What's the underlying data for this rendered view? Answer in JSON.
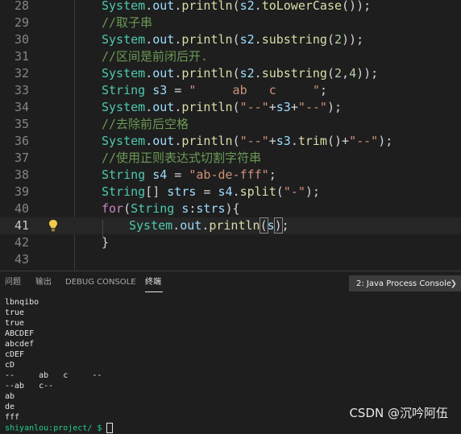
{
  "editor": {
    "lines": [
      {
        "num": "28",
        "tokens": [
          {
            "t": "System",
            "c": "cls"
          },
          {
            "t": ".",
            "c": "p"
          },
          {
            "t": "out",
            "c": "var"
          },
          {
            "t": ".",
            "c": "p"
          },
          {
            "t": "println",
            "c": "fn"
          },
          {
            "t": "(",
            "c": "p"
          },
          {
            "t": "s2",
            "c": "var"
          },
          {
            "t": ".",
            "c": "p"
          },
          {
            "t": "toLowerCase",
            "c": "fn"
          },
          {
            "t": "());",
            "c": "p"
          }
        ]
      },
      {
        "num": "29",
        "tokens": [
          {
            "t": "//取子串",
            "c": "com"
          }
        ]
      },
      {
        "num": "30",
        "tokens": [
          {
            "t": "System",
            "c": "cls"
          },
          {
            "t": ".",
            "c": "p"
          },
          {
            "t": "out",
            "c": "var"
          },
          {
            "t": ".",
            "c": "p"
          },
          {
            "t": "println",
            "c": "fn"
          },
          {
            "t": "(",
            "c": "p"
          },
          {
            "t": "s2",
            "c": "var"
          },
          {
            "t": ".",
            "c": "p"
          },
          {
            "t": "substring",
            "c": "fn"
          },
          {
            "t": "(",
            "c": "p"
          },
          {
            "t": "2",
            "c": "num"
          },
          {
            "t": "));",
            "c": "p"
          }
        ]
      },
      {
        "num": "31",
        "tokens": [
          {
            "t": "//区间是前闭后开.",
            "c": "com"
          }
        ]
      },
      {
        "num": "32",
        "tokens": [
          {
            "t": "System",
            "c": "cls"
          },
          {
            "t": ".",
            "c": "p"
          },
          {
            "t": "out",
            "c": "var"
          },
          {
            "t": ".",
            "c": "p"
          },
          {
            "t": "println",
            "c": "fn"
          },
          {
            "t": "(",
            "c": "p"
          },
          {
            "t": "s2",
            "c": "var"
          },
          {
            "t": ".",
            "c": "p"
          },
          {
            "t": "substring",
            "c": "fn"
          },
          {
            "t": "(",
            "c": "p"
          },
          {
            "t": "2",
            "c": "num"
          },
          {
            "t": ",",
            "c": "p"
          },
          {
            "t": "4",
            "c": "num"
          },
          {
            "t": "));",
            "c": "p"
          }
        ]
      },
      {
        "num": "33",
        "tokens": [
          {
            "t": "String",
            "c": "cls"
          },
          {
            "t": " ",
            "c": "p"
          },
          {
            "t": "s3",
            "c": "var"
          },
          {
            "t": " = ",
            "c": "p"
          },
          {
            "t": "\"     ab   c     \"",
            "c": "str"
          },
          {
            "t": ";",
            "c": "p"
          }
        ]
      },
      {
        "num": "34",
        "tokens": [
          {
            "t": "System",
            "c": "cls"
          },
          {
            "t": ".",
            "c": "p"
          },
          {
            "t": "out",
            "c": "var"
          },
          {
            "t": ".",
            "c": "p"
          },
          {
            "t": "println",
            "c": "fn"
          },
          {
            "t": "(",
            "c": "p"
          },
          {
            "t": "\"--\"",
            "c": "str"
          },
          {
            "t": "+",
            "c": "p"
          },
          {
            "t": "s3",
            "c": "var"
          },
          {
            "t": "+",
            "c": "p"
          },
          {
            "t": "\"--\"",
            "c": "str"
          },
          {
            "t": ");",
            "c": "p"
          }
        ]
      },
      {
        "num": "35",
        "tokens": [
          {
            "t": "//去除前后空格",
            "c": "com"
          }
        ]
      },
      {
        "num": "36",
        "tokens": [
          {
            "t": "System",
            "c": "cls"
          },
          {
            "t": ".",
            "c": "p"
          },
          {
            "t": "out",
            "c": "var"
          },
          {
            "t": ".",
            "c": "p"
          },
          {
            "t": "println",
            "c": "fn"
          },
          {
            "t": "(",
            "c": "p"
          },
          {
            "t": "\"--\"",
            "c": "str"
          },
          {
            "t": "+",
            "c": "p"
          },
          {
            "t": "s3",
            "c": "var"
          },
          {
            "t": ".",
            "c": "p"
          },
          {
            "t": "trim",
            "c": "fn"
          },
          {
            "t": "()+",
            "c": "p"
          },
          {
            "t": "\"--\"",
            "c": "str"
          },
          {
            "t": ");",
            "c": "p"
          }
        ]
      },
      {
        "num": "37",
        "tokens": [
          {
            "t": "//使用正则表达式切割字符串",
            "c": "com"
          }
        ]
      },
      {
        "num": "38",
        "tokens": [
          {
            "t": "String",
            "c": "cls"
          },
          {
            "t": " ",
            "c": "p"
          },
          {
            "t": "s4",
            "c": "var"
          },
          {
            "t": " = ",
            "c": "p"
          },
          {
            "t": "\"ab-de-fff\"",
            "c": "str"
          },
          {
            "t": ";",
            "c": "p"
          }
        ]
      },
      {
        "num": "39",
        "tokens": [
          {
            "t": "String",
            "c": "cls"
          },
          {
            "t": "[] ",
            "c": "p"
          },
          {
            "t": "strs",
            "c": "var"
          },
          {
            "t": " = ",
            "c": "p"
          },
          {
            "t": "s4",
            "c": "var"
          },
          {
            "t": ".",
            "c": "p"
          },
          {
            "t": "split",
            "c": "fn"
          },
          {
            "t": "(",
            "c": "p"
          },
          {
            "t": "\"-\"",
            "c": "str"
          },
          {
            "t": ");",
            "c": "p"
          }
        ]
      },
      {
        "num": "40",
        "tokens": [
          {
            "t": "for",
            "c": "kw"
          },
          {
            "t": "(",
            "c": "p"
          },
          {
            "t": "String",
            "c": "cls"
          },
          {
            "t": " ",
            "c": "p"
          },
          {
            "t": "s",
            "c": "var"
          },
          {
            "t": ":",
            "c": "p"
          },
          {
            "t": "strs",
            "c": "var"
          },
          {
            "t": "){",
            "c": "p"
          }
        ]
      },
      {
        "num": "41",
        "indent": 2,
        "active": true,
        "tokens": [
          {
            "t": "System",
            "c": "cls"
          },
          {
            "t": ".",
            "c": "p"
          },
          {
            "t": "out",
            "c": "var"
          },
          {
            "t": ".",
            "c": "p"
          },
          {
            "t": "println",
            "c": "fn"
          },
          {
            "t": "(",
            "c": "box"
          },
          {
            "t": "s",
            "c": "var"
          },
          {
            "t": ")",
            "c": "box"
          },
          {
            "t": ";",
            "c": "p"
          }
        ]
      },
      {
        "num": "42",
        "tokens": [
          {
            "t": "}",
            "c": "p"
          }
        ]
      },
      {
        "num": "43",
        "tokens": []
      }
    ],
    "lightbulb_icon": "lightbulb-icon"
  },
  "panel": {
    "tabs": [
      {
        "label": "问题",
        "active": false
      },
      {
        "label": "输出",
        "active": false
      },
      {
        "label": "DEBUG CONSOLE",
        "active": false
      },
      {
        "label": "终端",
        "active": true
      }
    ],
    "terminal_select": {
      "value": "2: Java Process Console",
      "icon": "chevron-down-icon"
    },
    "output": [
      "lbnqibo",
      "true",
      "true",
      "ABCDEF",
      "abcdef",
      "cDEF",
      "cD",
      "--     ab   c     --",
      "--ab   c--",
      "ab",
      "de",
      "fff"
    ],
    "prompt": "shiyanlou:project/ $"
  },
  "watermark": "CSDN @沉吟阿伍"
}
